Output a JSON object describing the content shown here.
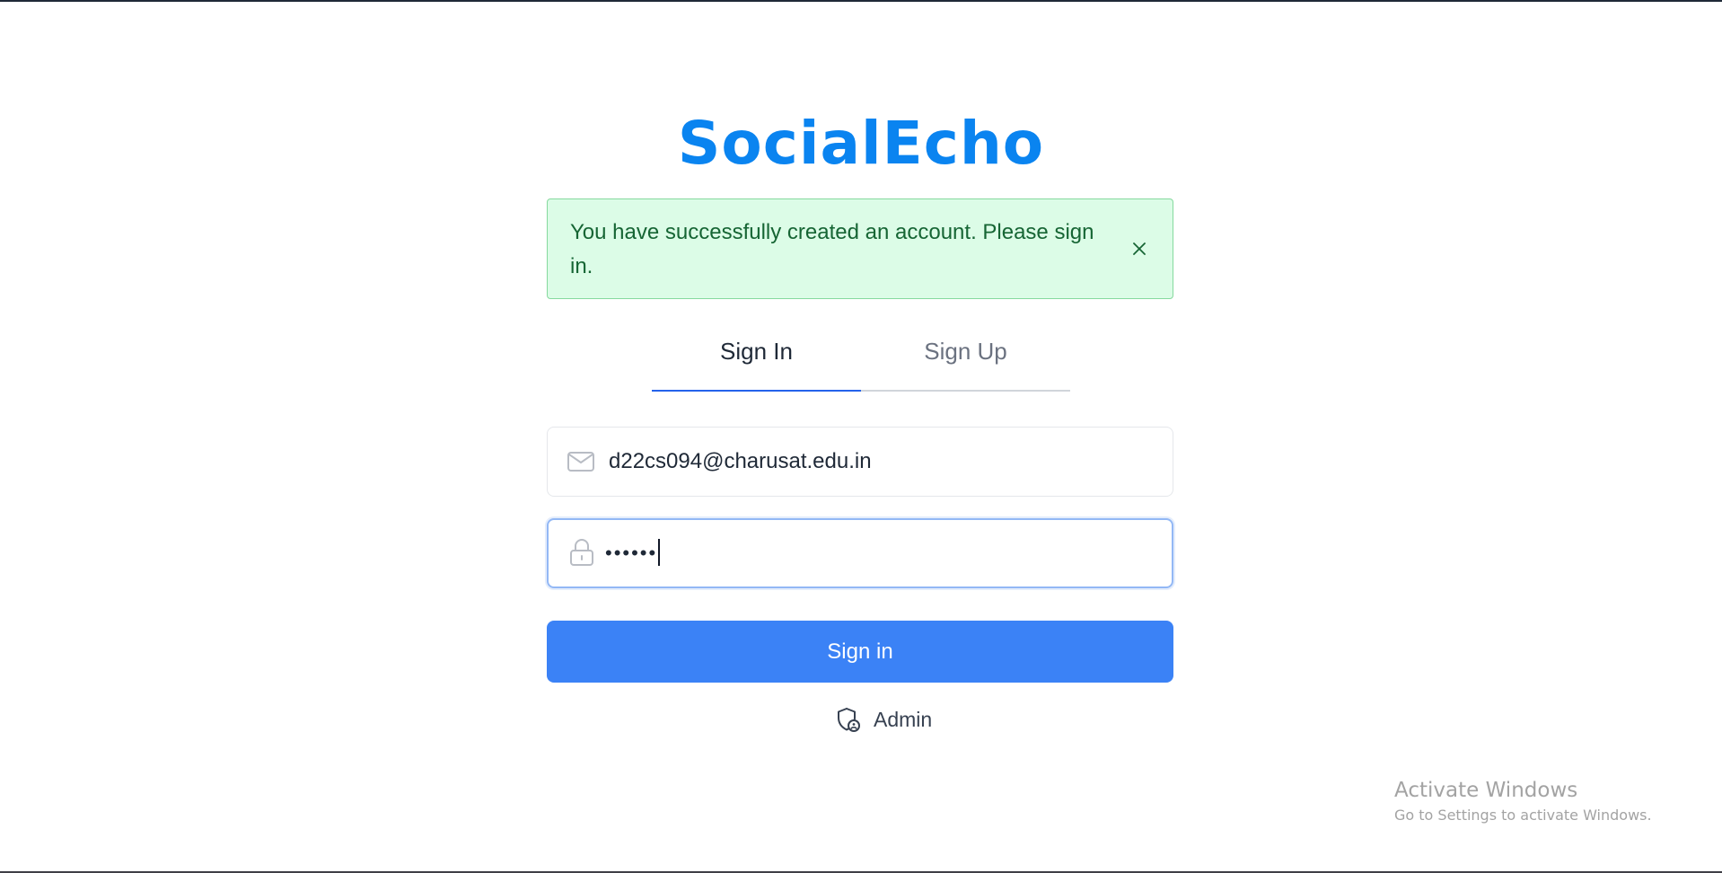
{
  "brand": {
    "name": "SocialEcho",
    "color": "#0a84f0"
  },
  "alert": {
    "message": "You have successfully created an account. Please sign in.",
    "close_icon": "close-icon",
    "status": "success"
  },
  "tabs": [
    {
      "label": "Sign In",
      "active": true
    },
    {
      "label": "Sign Up",
      "active": false
    }
  ],
  "form": {
    "email": {
      "icon": "mail-icon",
      "value": "d22cs094@charusat.edu.in"
    },
    "password": {
      "icon": "lock-icon",
      "value": "••••••",
      "focused": true
    },
    "submit_label": "Sign in"
  },
  "admin": {
    "icon": "shield-user-icon",
    "label": "Admin"
  },
  "watermark": {
    "title": "Activate Windows",
    "subtitle": "Go to Settings to activate Windows."
  }
}
